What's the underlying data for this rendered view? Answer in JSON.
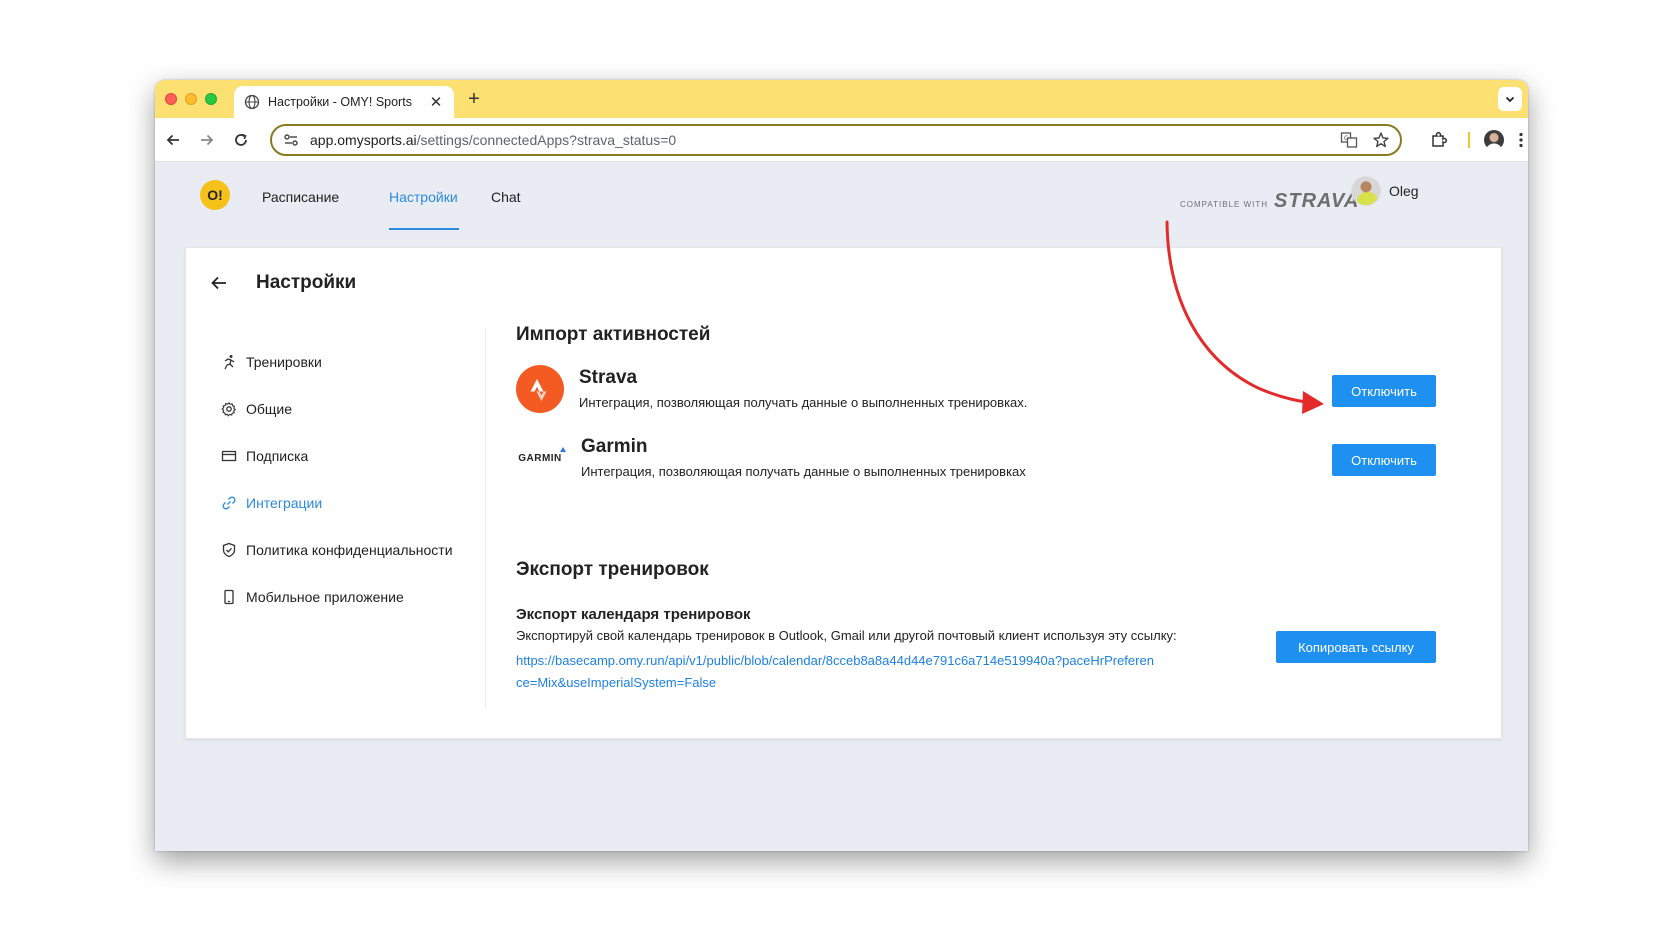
{
  "browser": {
    "tab_title": "Настройки - OMY! Sports",
    "url_host": "app.omysports.ai",
    "url_path": "/settings/connectedApps?strava_status=0"
  },
  "header": {
    "logo_text": "O!",
    "nav": [
      "Расписание",
      "Настройки",
      "Chat"
    ],
    "active_nav": "Настройки",
    "compatible_small": "COMPATIBLE WITH",
    "compatible_brand": "STRAVA",
    "user_name": "Oleg"
  },
  "page": {
    "title": "Настройки"
  },
  "sidebar": {
    "items": [
      {
        "label": "Тренировки",
        "icon": "runner-icon"
      },
      {
        "label": "Общие",
        "icon": "gear-icon"
      },
      {
        "label": "Подписка",
        "icon": "credit-card-icon"
      },
      {
        "label": "Интеграции",
        "icon": "link-icon",
        "active": true
      },
      {
        "label": "Политика конфиденциальности",
        "icon": "shield-icon"
      },
      {
        "label": "Мобильное приложение",
        "icon": "phone-icon"
      }
    ]
  },
  "import": {
    "title": "Импорт активностей",
    "integrations": [
      {
        "name": "Strava",
        "description": "Интеграция, позволяющая получать данные о выполненных тренировках.",
        "button": "Отключить"
      },
      {
        "name": "Garmin",
        "logo_text": "GARMIN",
        "description": "Интеграция, позволяющая получать данные о выполненных тренировках",
        "button": "Отключить"
      }
    ]
  },
  "export": {
    "title": "Экспорт тренировок",
    "subtitle": "Экспорт календаря тренировок",
    "text": "Экспортируй свой календарь тренировок в Outlook, Gmail или другой почтовый клиент используя эту ссылку:",
    "link": "https://basecamp.omy.run/api/v1/public/blob/calendar/8cceb8a8a44d44e791c6a714e519940a?paceHrPreference=Mix&useImperialSystem=False",
    "button": "Копировать ссылку"
  },
  "colors": {
    "accent": "#1e90f0",
    "tabbar": "#fde072",
    "strava": "#f35b22",
    "annotation_arrow": "#e32b2b"
  }
}
